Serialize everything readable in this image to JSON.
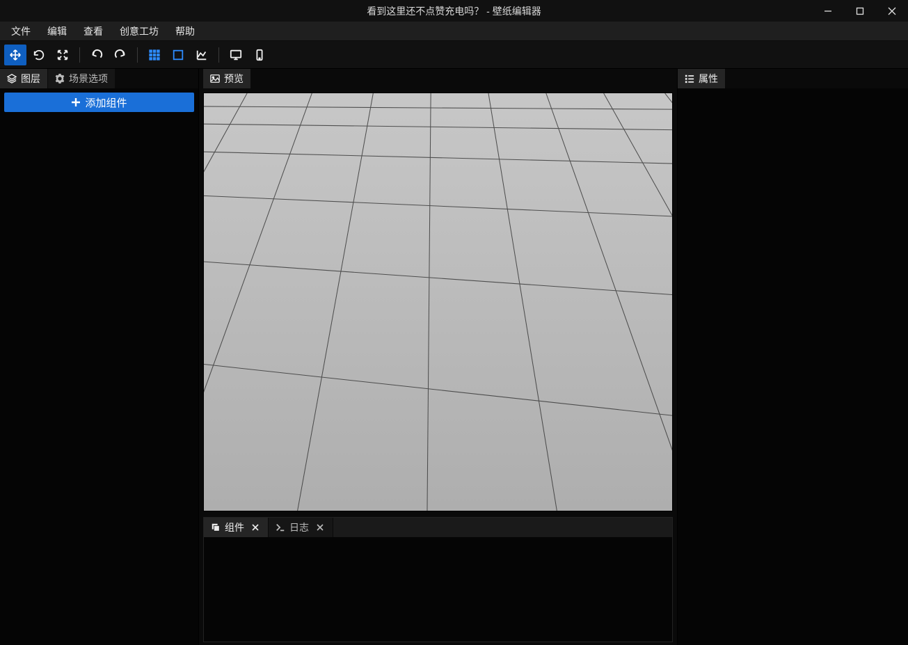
{
  "window": {
    "title": "看到这里还不点赞充电吗？ - 壁纸编辑器"
  },
  "menu": {
    "items": [
      "文件",
      "编辑",
      "查看",
      "创意工坊",
      "帮助"
    ]
  },
  "left_panel": {
    "tabs": {
      "layers": "图层",
      "scene_options": "场景选项"
    },
    "add_component": "添加组件"
  },
  "center_panel": {
    "tabs": {
      "preview": "预览"
    },
    "bottom_tabs": {
      "components": "组件",
      "log": "日志"
    }
  },
  "right_panel": {
    "tabs": {
      "properties": "属性"
    }
  },
  "colors": {
    "accent": "#1a6fd8",
    "toolbar_active": "#0f5fc0",
    "blue_icon": "#2d8cff",
    "bg_dark": "#0a0a0a",
    "canvas_grey": "#b8b8b8"
  }
}
